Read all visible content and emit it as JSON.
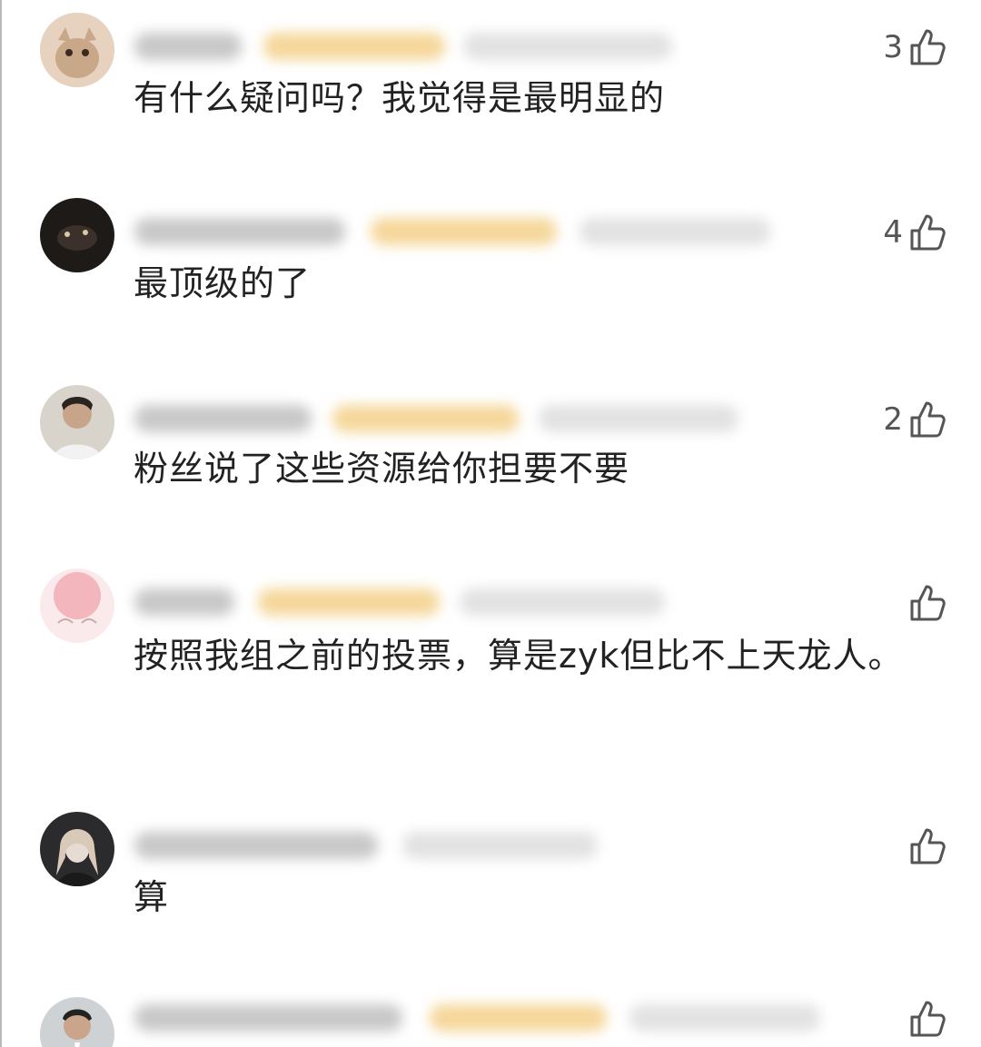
{
  "comments": [
    {
      "text": "有什么疑问吗？我觉得是最明显的",
      "likes": "3",
      "avatar": "avatar-cat-icon",
      "like_icon": "thumbs-up-icon"
    },
    {
      "text": "最顶级的了",
      "likes": "4",
      "avatar": "avatar-dark-icon",
      "like_icon": "thumbs-up-icon"
    },
    {
      "text": "粉丝说了这些资源给你担要不要",
      "likes": "2",
      "avatar": "avatar-person-icon",
      "like_icon": "thumbs-up-icon"
    },
    {
      "text": "按照我组之前的投票，算是zyk但比不上天龙人。",
      "likes": "",
      "avatar": "avatar-pink-icon",
      "like_icon": "thumbs-up-icon"
    },
    {
      "text": "算",
      "likes": "",
      "avatar": "avatar-portrait-icon",
      "like_icon": "thumbs-up-icon"
    },
    {
      "text": "",
      "likes": "",
      "avatar": "avatar-man-icon",
      "like_icon": "thumbs-up-icon"
    }
  ],
  "colors": {
    "text": "#222222",
    "like": "#555555",
    "badge_blur": "#f5d79a",
    "name_blur": "#c8c8c8"
  }
}
